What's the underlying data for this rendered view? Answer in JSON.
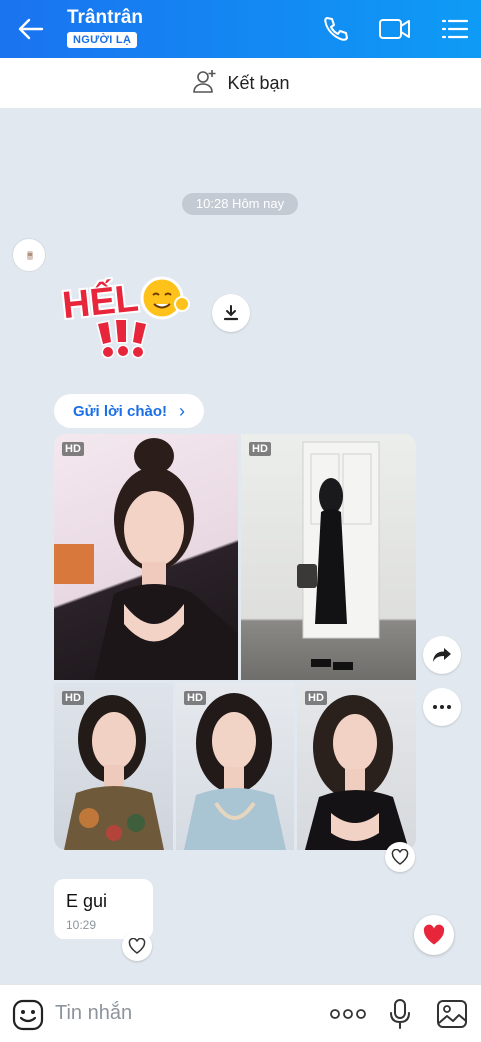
{
  "header": {
    "title": "Trântrân",
    "badge": "NGƯỜI LẠ",
    "icons": [
      "back-arrow-icon",
      "phone-icon",
      "video-call-icon",
      "menu-list-icon"
    ]
  },
  "friend_bar": {
    "label": "Kết bạn",
    "icon": "add-friend-icon"
  },
  "timestamp": "10:28 Hôm nay",
  "sticker": {
    "text": "HẾLLO!!!"
  },
  "greeting_button": {
    "label": "Gửi lời chào!",
    "chevron": "›"
  },
  "album": {
    "photos": [
      {
        "badge": "HD",
        "desc": "selfie-pink"
      },
      {
        "badge": "HD",
        "desc": "black-dress-full"
      },
      {
        "badge": "HD",
        "desc": "floral-top"
      },
      {
        "badge": "HD",
        "desc": "blue-lace"
      },
      {
        "badge": "HD",
        "desc": "black-lace"
      }
    ]
  },
  "message": {
    "text": "E gui",
    "time": "10:29"
  },
  "composer": {
    "placeholder": "Tin nhắn",
    "more": "ooo"
  },
  "colors": {
    "header_start": "#1a73f0",
    "header_end": "#0e9bf5",
    "accent": "#1a6fe6",
    "chat_bg": "#e2e8ef",
    "heart": "#e8263b"
  }
}
